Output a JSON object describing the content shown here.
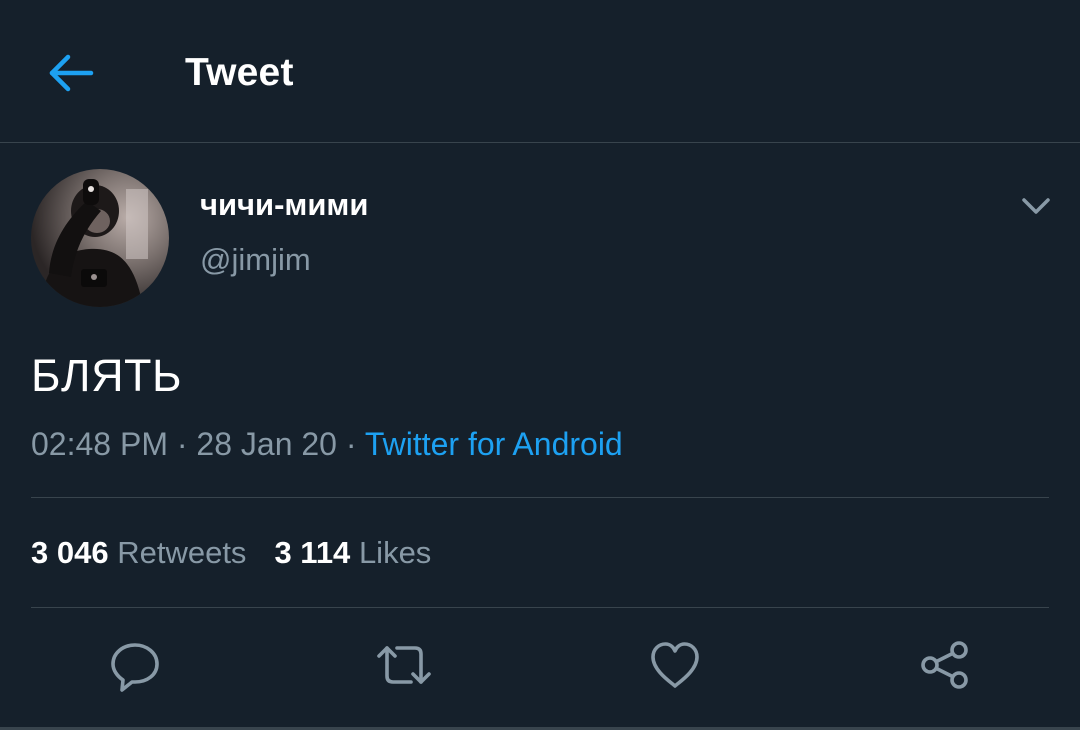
{
  "header": {
    "title": "Tweet",
    "back_icon": "arrow-left-icon",
    "accent_color": "#1da1f2"
  },
  "tweet": {
    "author": {
      "display_name": "чичи-мими",
      "handle": "@jimjim",
      "avatar_icon": "profile-photo"
    },
    "text": "БЛЯТЬ",
    "time": "02:48 PM",
    "separator": "·",
    "date": "28 Jan 20",
    "source": "Twitter for Android",
    "menu_icon": "chevron-down-icon"
  },
  "stats": {
    "retweets_count": "3 046",
    "retweets_label": "Retweets",
    "likes_count": "3 114",
    "likes_label": "Likes"
  },
  "actions": [
    {
      "icon": "reply-icon"
    },
    {
      "icon": "retweet-icon"
    },
    {
      "icon": "like-icon"
    },
    {
      "icon": "share-icon"
    }
  ],
  "colors": {
    "background": "#15202b",
    "divider": "#38444d",
    "secondary_text": "#8899a6",
    "link": "#1da1f2"
  }
}
